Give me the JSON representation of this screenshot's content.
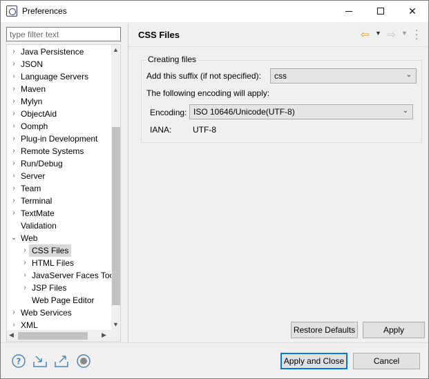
{
  "window": {
    "title": "Preferences"
  },
  "filter": {
    "placeholder": "type filter text"
  },
  "tree": {
    "items": [
      {
        "label": "Java Persistence",
        "level": 0,
        "expandable": true
      },
      {
        "label": "JSON",
        "level": 0,
        "expandable": true
      },
      {
        "label": "Language Servers",
        "level": 0,
        "expandable": true
      },
      {
        "label": "Maven",
        "level": 0,
        "expandable": true
      },
      {
        "label": "Mylyn",
        "level": 0,
        "expandable": true
      },
      {
        "label": "ObjectAid",
        "level": 0,
        "expandable": true
      },
      {
        "label": "Oomph",
        "level": 0,
        "expandable": true
      },
      {
        "label": "Plug-in Development",
        "level": 0,
        "expandable": true
      },
      {
        "label": "Remote Systems",
        "level": 0,
        "expandable": true
      },
      {
        "label": "Run/Debug",
        "level": 0,
        "expandable": true
      },
      {
        "label": "Server",
        "level": 0,
        "expandable": true
      },
      {
        "label": "Team",
        "level": 0,
        "expandable": true
      },
      {
        "label": "Terminal",
        "level": 0,
        "expandable": true
      },
      {
        "label": "TextMate",
        "level": 0,
        "expandable": true
      },
      {
        "label": "Validation",
        "level": 0,
        "expandable": false
      },
      {
        "label": "Web",
        "level": 0,
        "expandable": true,
        "expanded": true
      },
      {
        "label": "CSS Files",
        "level": 1,
        "expandable": true,
        "selected": true
      },
      {
        "label": "HTML Files",
        "level": 1,
        "expandable": true
      },
      {
        "label": "JavaServer Faces Too",
        "level": 1,
        "expandable": true
      },
      {
        "label": "JSP Files",
        "level": 1,
        "expandable": true
      },
      {
        "label": "Web Page Editor",
        "level": 1,
        "expandable": false
      },
      {
        "label": "Web Services",
        "level": 0,
        "expandable": true
      },
      {
        "label": "XML",
        "level": 0,
        "expandable": true
      }
    ]
  },
  "page": {
    "title": "CSS Files",
    "group_title": "Creating files",
    "suffix_label": "Add this suffix (if not specified):",
    "suffix_value": "css",
    "encoding_note": "The following encoding will apply:",
    "encoding_label": "Encoding:",
    "encoding_value": "ISO 10646/Unicode(UTF-8)",
    "iana_label": "IANA:",
    "iana_value": "UTF-8"
  },
  "buttons": {
    "restore_defaults": "Restore Defaults",
    "apply": "Apply",
    "apply_and_close": "Apply and Close",
    "cancel": "Cancel"
  },
  "colors": {
    "nav_back": "#e0a000",
    "bottom_icons": "#4b86b8",
    "default_button_border": "#0078d7"
  }
}
